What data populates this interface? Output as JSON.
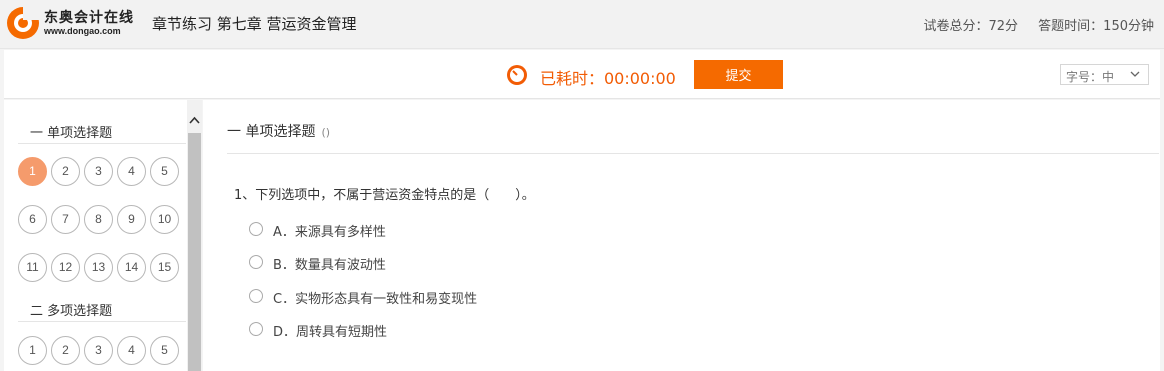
{
  "header": {
    "logo_name": "东奥会计在线",
    "logo_url": "www.dongao.com",
    "exam_title": "章节练习 第七章 营运资金管理",
    "total_score": "试卷总分：72分",
    "answer_time": "答题时间：150分钟"
  },
  "toolbar": {
    "timer_label": "已耗时：00:00:00",
    "submit_label": "提交",
    "font_size_label": "字号：中",
    "accent_color": "#f56a00"
  },
  "sidebar": {
    "sections": [
      {
        "title": "一 单项选择题",
        "questions": [
          "1",
          "2",
          "3",
          "4",
          "5",
          "6",
          "7",
          "8",
          "9",
          "10",
          "11",
          "12",
          "13",
          "14",
          "15"
        ],
        "active": "1"
      },
      {
        "title": "二 多项选择题",
        "questions": [
          "1",
          "2",
          "3",
          "4",
          "5"
        ]
      }
    ]
  },
  "main": {
    "section_title": "一 单项选择题",
    "section_paren": "()",
    "question": "1、下列选项中，不属于营运资金特点的是（　　）。",
    "options": [
      "A．来源具有多样性",
      "B．数量具有波动性",
      "C．实物形态具有一致性和易变现性",
      "D．周转具有短期性"
    ]
  }
}
